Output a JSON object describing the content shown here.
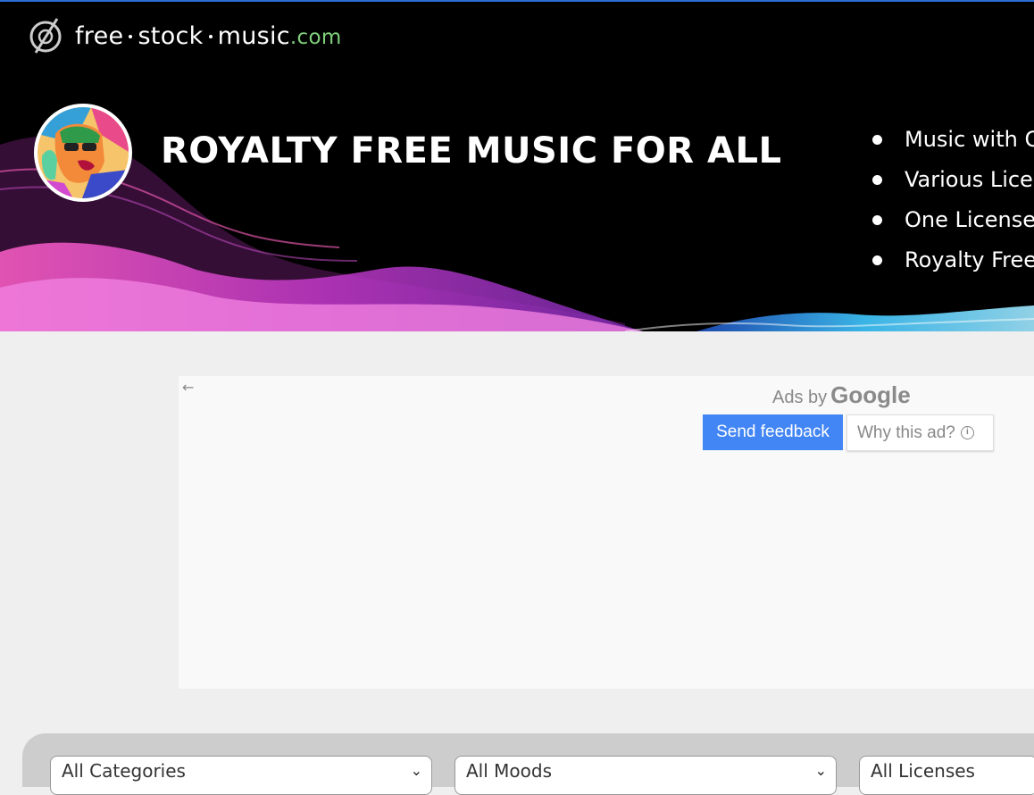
{
  "header": {
    "logo": {
      "word1": "free",
      "word2": "stock",
      "word3": "music",
      "tld": ".com"
    },
    "title": "ROYALTY FREE MUSIC FOR ALL",
    "features": [
      "Music with C",
      "Various Licen",
      "One License",
      "Royalty Free"
    ]
  },
  "ad": {
    "back_glyph": "←",
    "ads_by": "Ads by",
    "google": "Google",
    "send_feedback": "Send feedback",
    "why_this_ad": "Why this ad?",
    "info_glyph": "i"
  },
  "filters": {
    "categories": "All Categories",
    "moods": "All Moods",
    "licenses": "All Licenses",
    "chevron": "⌄"
  },
  "colors": {
    "accent": "#4285f4",
    "tld": "#7fcf7a",
    "hero_bg": "#000000",
    "wave_pink": "#e040c0",
    "wave_blue": "#40c8ff"
  }
}
